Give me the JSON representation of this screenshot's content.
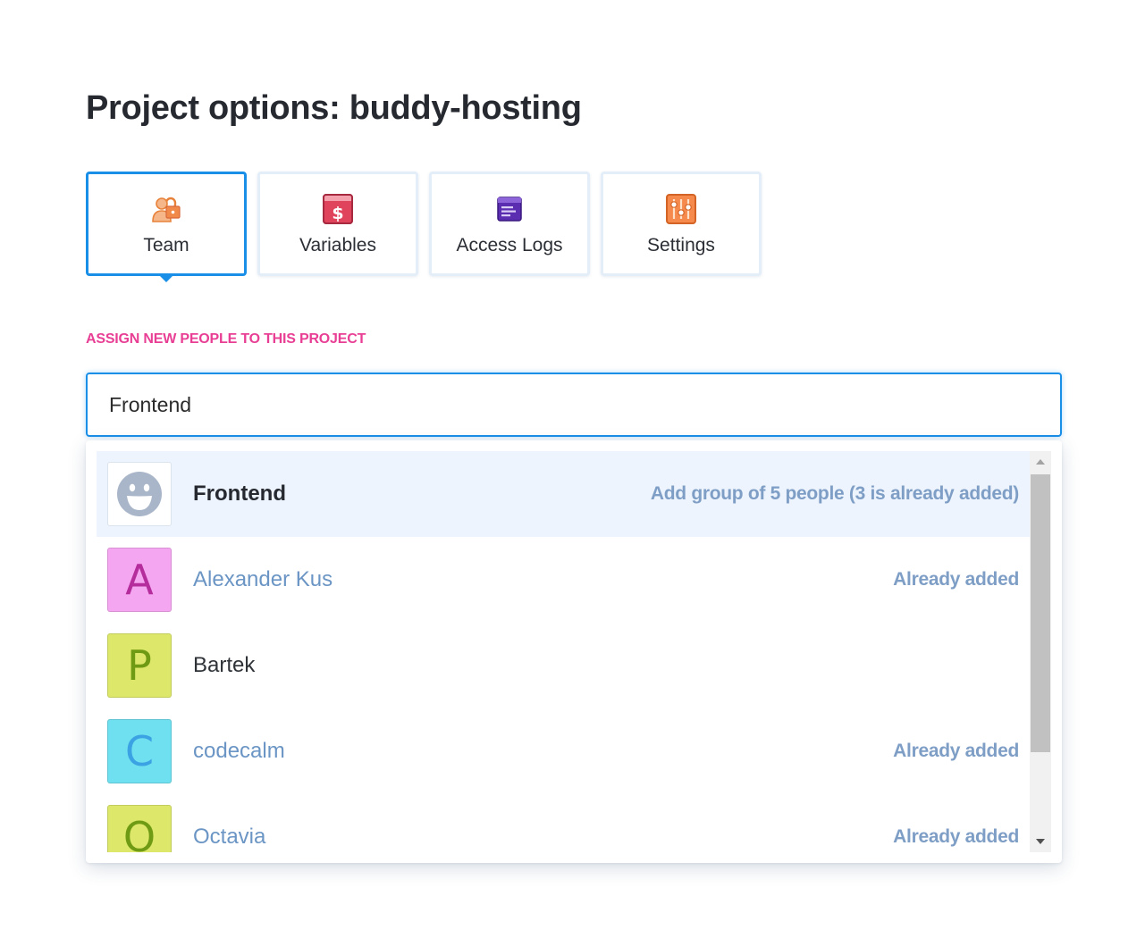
{
  "page": {
    "title": "Project options: buddy-hosting"
  },
  "tabs": [
    {
      "label": "Team",
      "icon": "team-lock-icon",
      "active": true
    },
    {
      "label": "Variables",
      "icon": "dollar-icon",
      "active": false
    },
    {
      "label": "Access Logs",
      "icon": "log-list-icon",
      "active": false
    },
    {
      "label": "Settings",
      "icon": "sliders-icon",
      "active": false
    }
  ],
  "assign": {
    "label": "ASSIGN NEW PEOPLE TO THIS PROJECT",
    "search_value": "Frontend"
  },
  "results": [
    {
      "name": "Frontend",
      "type": "group",
      "avatar_icon": "smiley-face-icon",
      "status": "Add group of 5 people (3 is already added)",
      "highlighted": true,
      "added": false,
      "avatar_color": "#a9b6c9"
    },
    {
      "name": "Alexander Kus",
      "type": "user",
      "avatar_letter": "A",
      "status": "Already added",
      "highlighted": false,
      "added": true,
      "avatar_bg": "#f5a6f1",
      "avatar_fg": "#b52d9c"
    },
    {
      "name": "Bartek",
      "type": "user",
      "avatar_letter": "P",
      "status": "",
      "highlighted": false,
      "added": false,
      "avatar_bg": "#dde86a",
      "avatar_fg": "#6f9a13"
    },
    {
      "name": "codecalm",
      "type": "user",
      "avatar_letter": "C",
      "status": "Already added",
      "highlighted": false,
      "added": true,
      "avatar_bg": "#6fe0ef",
      "avatar_fg": "#3ba3e3"
    },
    {
      "name": "Octavia",
      "type": "user",
      "avatar_letter": "O",
      "status": "Already added",
      "highlighted": false,
      "added": true,
      "avatar_bg": "#dde86a",
      "avatar_fg": "#6f9a13"
    }
  ],
  "colors": {
    "accent": "#1a8fe8",
    "section_label": "#e83f95",
    "added_name": "#6b95c4",
    "status_text": "#7e9ec6",
    "highlight_bg": "#edf4fd"
  }
}
